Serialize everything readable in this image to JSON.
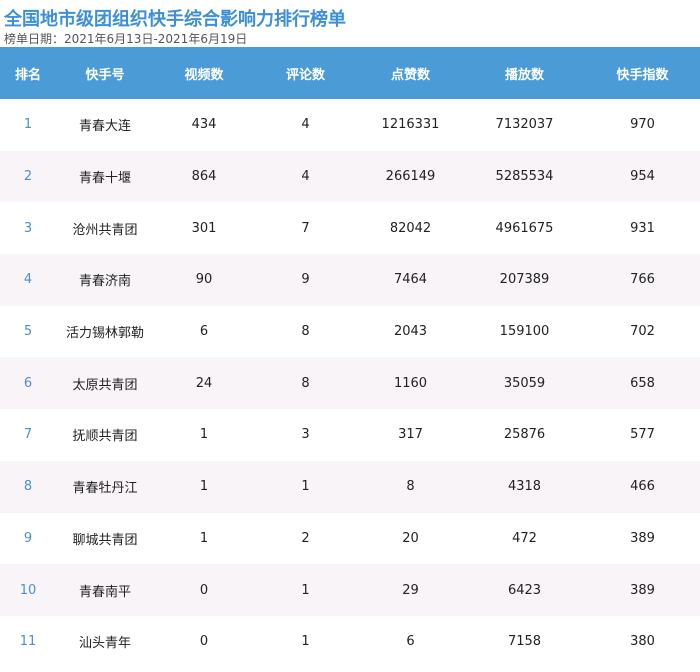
{
  "title": "全国地市级团组织快手综合影响力排行榜单",
  "subtitle": "榜单日期：2021年6月13日-2021年6月19日",
  "columns": [
    "排名",
    "快手号",
    "视频数",
    "评论数",
    "点赞数",
    "播放数",
    "快手指数"
  ],
  "rows": [
    {
      "rank": "1",
      "account": "青春大连",
      "videos": "434",
      "comments": "4",
      "likes": "1216331",
      "plays": "7132037",
      "index": "970"
    },
    {
      "rank": "2",
      "account": "青春十堰",
      "videos": "864",
      "comments": "4",
      "likes": "266149",
      "plays": "5285534",
      "index": "954"
    },
    {
      "rank": "3",
      "account": "沧州共青团",
      "videos": "301",
      "comments": "7",
      "likes": "82042",
      "plays": "4961675",
      "index": "931"
    },
    {
      "rank": "4",
      "account": "青春济南",
      "videos": "90",
      "comments": "9",
      "likes": "7464",
      "plays": "207389",
      "index": "766"
    },
    {
      "rank": "5",
      "account": "活力锡林郭勒",
      "videos": "6",
      "comments": "8",
      "likes": "2043",
      "plays": "159100",
      "index": "702"
    },
    {
      "rank": "6",
      "account": "太原共青团",
      "videos": "24",
      "comments": "8",
      "likes": "1160",
      "plays": "35059",
      "index": "658"
    },
    {
      "rank": "7",
      "account": "抚顺共青团",
      "videos": "1",
      "comments": "3",
      "likes": "317",
      "plays": "25876",
      "index": "577"
    },
    {
      "rank": "8",
      "account": "青春牡丹江",
      "videos": "1",
      "comments": "1",
      "likes": "8",
      "plays": "4318",
      "index": "466"
    },
    {
      "rank": "9",
      "account": "聊城共青团",
      "videos": "1",
      "comments": "2",
      "likes": "20",
      "plays": "472",
      "index": "389"
    },
    {
      "rank": "10",
      "account": "青春南平",
      "videos": "0",
      "comments": "1",
      "likes": "29",
      "plays": "6423",
      "index": "389"
    },
    {
      "rank": "11",
      "account": "汕头青年",
      "videos": "0",
      "comments": "1",
      "likes": "6",
      "plays": "7158",
      "index": "380"
    }
  ],
  "colors": {
    "title": "#3d8fd6",
    "header_bg": "#4a9bd6",
    "rank_text": "#4a8fcf",
    "stripe_bg": "#f8f4f8"
  }
}
